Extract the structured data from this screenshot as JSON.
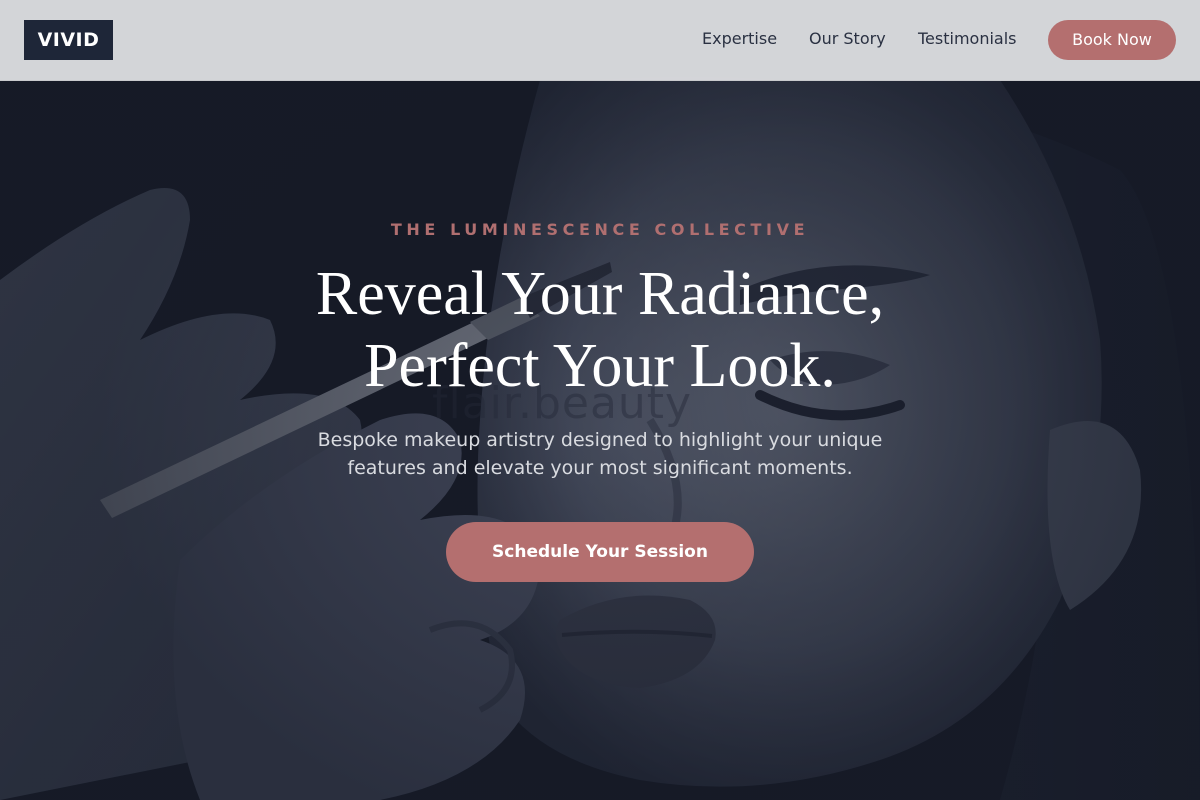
{
  "brand": {
    "logo_text": "VIVID"
  },
  "nav": {
    "links": [
      {
        "label": "Expertise"
      },
      {
        "label": "Our Story"
      },
      {
        "label": "Testimonials"
      }
    ],
    "cta_label": "Book Now"
  },
  "hero": {
    "eyebrow": "THE LUMINESCENCE COLLECTIVE",
    "headline_line1": "Reveal Your Radiance,",
    "headline_line2": "Perfect Your Look.",
    "subtext": "Bespoke makeup artistry designed to highlight your unique features and elevate your most significant moments.",
    "cta_label": "Schedule Your Session",
    "watermark": "flair.beauty"
  },
  "colors": {
    "accent": "#b46f6f",
    "logo_bg": "#1e2638",
    "navbar_bg": "#dcdde0",
    "hero_bg": "#161b28"
  }
}
